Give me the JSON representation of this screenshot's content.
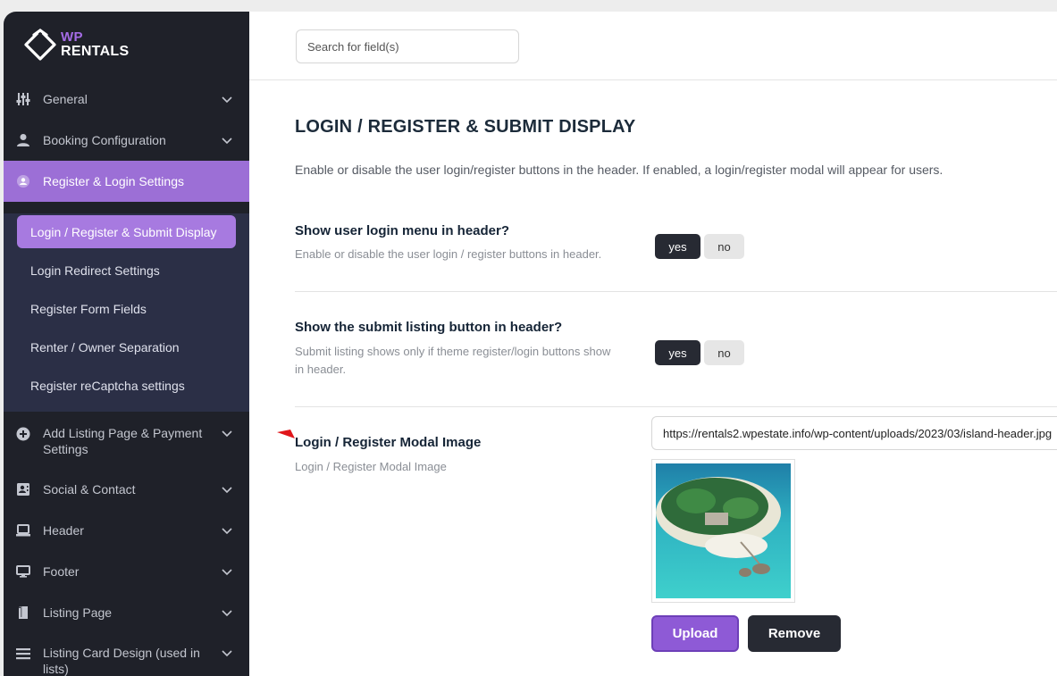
{
  "brand": {
    "wp": "WP",
    "rentals": "RENTALS",
    "accent": "#a56ce6"
  },
  "sidebar": {
    "items": [
      {
        "label": "General",
        "icon": "sliders-icon"
      },
      {
        "label": "Booking Configuration",
        "icon": "user-icon"
      },
      {
        "label": "Register & Login Settings",
        "icon": "user-circle-icon"
      },
      {
        "label": "Add Listing Page & Payment Settings",
        "icon": "plus-circle-icon"
      },
      {
        "label": "Social & Contact",
        "icon": "contact-card-icon"
      },
      {
        "label": "Header",
        "icon": "laptop-icon"
      },
      {
        "label": "Footer",
        "icon": "monitor-icon"
      },
      {
        "label": "Listing Page",
        "icon": "document-icon"
      },
      {
        "label": "Listing Card Design (used in lists)",
        "icon": "list-icon"
      }
    ],
    "subitems": [
      {
        "label": "Login / Register & Submit Display"
      },
      {
        "label": "Login Redirect Settings"
      },
      {
        "label": "Register Form Fields"
      },
      {
        "label": "Renter / Owner Separation"
      },
      {
        "label": "Register reCaptcha settings"
      }
    ]
  },
  "search": {
    "placeholder": "Search for field(s)"
  },
  "page": {
    "title": "LOGIN / REGISTER & SUBMIT DISPLAY",
    "description": "Enable or disable the user login/register buttons in the header. If enabled, a login/register modal will appear for users."
  },
  "options": [
    {
      "title": "Show user login menu in header?",
      "description": "Enable or disable the user login / register buttons in header.",
      "yes": "yes",
      "no": "no",
      "selected": "yes"
    },
    {
      "title": "Show the submit listing button in header?",
      "description": "Submit listing shows only if theme register/login buttons show in header.",
      "yes": "yes",
      "no": "no",
      "selected": "yes"
    }
  ],
  "modal_image": {
    "title": "Login / Register Modal Image",
    "description": "Login / Register Modal Image",
    "url": "https://rentals2.wpestate.info/wp-content/uploads/2023/03/island-header.jpg",
    "upload_label": "Upload",
    "remove_label": "Remove"
  }
}
